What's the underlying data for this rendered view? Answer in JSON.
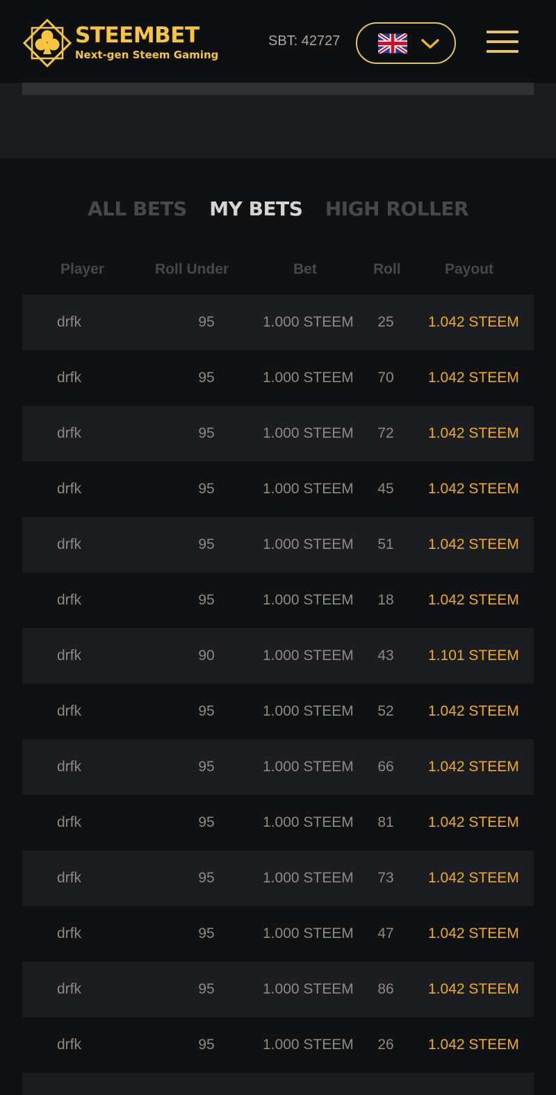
{
  "header": {
    "brand_name": "STEEMBET",
    "brand_tagline": "Next-gen Steem Gaming",
    "balance": "SBT: 42727",
    "language_flag": "uk-flag-icon",
    "accent_color": "#f5c542"
  },
  "tabs": [
    {
      "label": "ALL BETS",
      "active": false
    },
    {
      "label": "MY BETS",
      "active": true
    },
    {
      "label": "HIGH ROLLER",
      "active": false
    }
  ],
  "table": {
    "headers": [
      "Player",
      "Roll Under",
      "Bet",
      "Roll",
      "Payout"
    ],
    "rows": [
      {
        "player": "drfk",
        "roll_under": "95",
        "bet": "1.000 STEEM",
        "roll": "25",
        "payout": "1.042 STEEM"
      },
      {
        "player": "drfk",
        "roll_under": "95",
        "bet": "1.000 STEEM",
        "roll": "70",
        "payout": "1.042 STEEM"
      },
      {
        "player": "drfk",
        "roll_under": "95",
        "bet": "1.000 STEEM",
        "roll": "72",
        "payout": "1.042 STEEM"
      },
      {
        "player": "drfk",
        "roll_under": "95",
        "bet": "1.000 STEEM",
        "roll": "45",
        "payout": "1.042 STEEM"
      },
      {
        "player": "drfk",
        "roll_under": "95",
        "bet": "1.000 STEEM",
        "roll": "51",
        "payout": "1.042 STEEM"
      },
      {
        "player": "drfk",
        "roll_under": "95",
        "bet": "1.000 STEEM",
        "roll": "18",
        "payout": "1.042 STEEM"
      },
      {
        "player": "drfk",
        "roll_under": "90",
        "bet": "1.000 STEEM",
        "roll": "43",
        "payout": "1.101 STEEM"
      },
      {
        "player": "drfk",
        "roll_under": "95",
        "bet": "1.000 STEEM",
        "roll": "52",
        "payout": "1.042 STEEM"
      },
      {
        "player": "drfk",
        "roll_under": "95",
        "bet": "1.000 STEEM",
        "roll": "66",
        "payout": "1.042 STEEM"
      },
      {
        "player": "drfk",
        "roll_under": "95",
        "bet": "1.000 STEEM",
        "roll": "81",
        "payout": "1.042 STEEM"
      },
      {
        "player": "drfk",
        "roll_under": "95",
        "bet": "1.000 STEEM",
        "roll": "73",
        "payout": "1.042 STEEM"
      },
      {
        "player": "drfk",
        "roll_under": "95",
        "bet": "1.000 STEEM",
        "roll": "47",
        "payout": "1.042 STEEM"
      },
      {
        "player": "drfk",
        "roll_under": "95",
        "bet": "1.000 STEEM",
        "roll": "86",
        "payout": "1.042 STEEM"
      },
      {
        "player": "drfk",
        "roll_under": "95",
        "bet": "1.000 STEEM",
        "roll": "26",
        "payout": "1.042 STEEM"
      },
      {
        "player": "",
        "roll_under": "",
        "bet": "",
        "roll": "",
        "payout": ""
      }
    ]
  }
}
